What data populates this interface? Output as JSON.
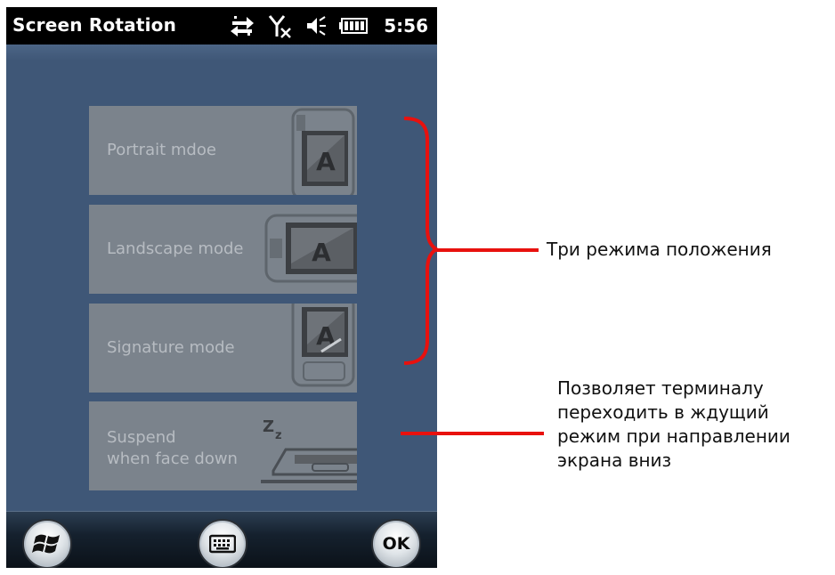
{
  "statusbar": {
    "title": "Screen Rotation",
    "time": "5:56",
    "icons": [
      "sync-arrows-icon",
      "no-signal-icon",
      "speaker-icon",
      "battery-icon"
    ]
  },
  "tiles": {
    "portrait": {
      "label": "Portrait mdoe",
      "icon": "device-portrait-icon"
    },
    "landscape": {
      "label": "Landscape mode",
      "icon": "device-landscape-icon"
    },
    "signature": {
      "label": "Signature mode",
      "icon": "device-signature-icon"
    },
    "suspend": {
      "label_line1": "Suspend",
      "label_line2": "when face down",
      "icon": "device-face-down-icon"
    }
  },
  "bottombar": {
    "start_icon": "windows-logo-icon",
    "keyboard_icon": "keyboard-icon",
    "ok_label": "OK"
  },
  "annotations": {
    "three_modes": "Три режима положения",
    "suspend_line1": "Позволяет терминалу",
    "suspend_line2": "переходить в ждущий",
    "suspend_line3": "режим при направлении",
    "suspend_line4": "экрана вниз"
  },
  "colors": {
    "screen_bg": "#3f5777",
    "tile_bg": "#7b838c",
    "annotation_red": "#e8110e"
  }
}
